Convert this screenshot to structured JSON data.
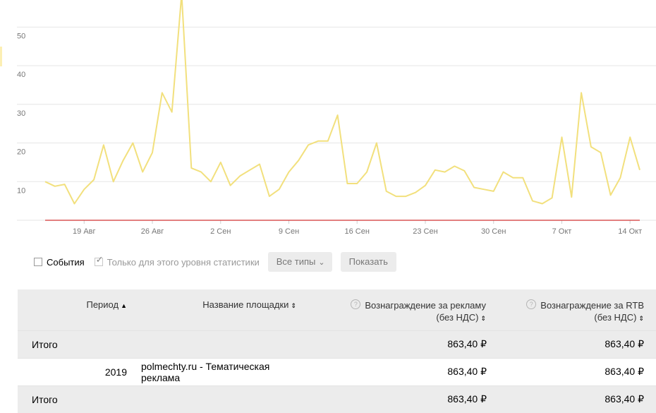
{
  "chart_data": {
    "type": "line",
    "series": [
      {
        "color": "#f2e07d",
        "values": [
          10,
          8.8,
          9.3,
          4.3,
          8,
          10.5,
          19.5,
          10,
          15.5,
          20,
          12.5,
          17.5,
          33,
          28,
          58.5,
          13.5,
          12.5,
          10,
          15,
          9,
          11.5,
          13,
          14.5,
          6.2,
          8,
          12.5,
          15.5,
          19.5,
          20.5,
          20.5,
          27.2,
          9.5,
          9.5,
          12.5,
          20,
          7.5,
          6.2,
          6.2,
          7.2,
          9,
          13,
          12.5,
          14,
          12.8,
          8.5,
          8,
          7.5,
          12.5,
          11,
          11,
          5,
          4.3,
          5.8,
          21.5,
          6,
          33,
          19,
          17.5,
          6.5,
          11,
          21.5,
          13
        ]
      },
      {
        "color": "#d23333",
        "values": [
          0,
          0,
          0,
          0,
          0,
          0,
          0,
          0,
          0,
          0,
          0,
          0,
          0,
          0,
          0,
          0,
          0,
          0,
          0,
          0,
          0,
          0,
          0,
          0,
          0,
          0,
          0,
          0,
          0,
          0,
          0,
          0,
          0,
          0,
          0,
          0,
          0,
          0,
          0,
          0,
          0,
          0,
          0,
          0,
          0,
          0,
          0,
          0,
          0,
          0,
          0,
          0,
          0,
          0,
          0,
          0,
          0,
          0,
          0,
          0,
          0,
          0
        ]
      }
    ],
    "yticks": [
      10,
      20,
      30,
      40,
      50
    ],
    "xtick_labels": [
      {
        "label": "19 Авг",
        "index": 4
      },
      {
        "label": "26 Авг",
        "index": 11
      },
      {
        "label": "2 Сен",
        "index": 18
      },
      {
        "label": "9 Сен",
        "index": 25
      },
      {
        "label": "16 Сен",
        "index": 32
      },
      {
        "label": "23 Сен",
        "index": 39
      },
      {
        "label": "30 Сен",
        "index": 46
      },
      {
        "label": "7 Окт",
        "index": 53
      },
      {
        "label": "14 Окт",
        "index": 60
      }
    ],
    "ylim": [
      0,
      57
    ],
    "grid": true
  },
  "controls": {
    "events_label": "События",
    "level_label": "Только для этого уровня статистики",
    "types_label": "Все типы",
    "show_label": "Показать"
  },
  "table": {
    "headers": {
      "period": "Период",
      "site": "Название площадки",
      "reward_ad_line1": "Вознаграждение за рекламу",
      "reward_ad_line2": "(без НДС)",
      "reward_rtb_line1": "Вознаграждение за RTB",
      "reward_rtb_line2": "(без НДС)"
    },
    "total_top": {
      "label": "Итого",
      "reward_ad": "863,40 ₽",
      "reward_rtb": "863,40 ₽"
    },
    "row": {
      "period": "2019",
      "site": "polmechty.ru - Тематическая реклама",
      "reward_ad": "863,40 ₽",
      "reward_rtb": "863,40 ₽"
    },
    "total_bottom": {
      "label": "Итого",
      "reward_ad": "863,40 ₽",
      "reward_rtb": "863,40 ₽"
    }
  }
}
